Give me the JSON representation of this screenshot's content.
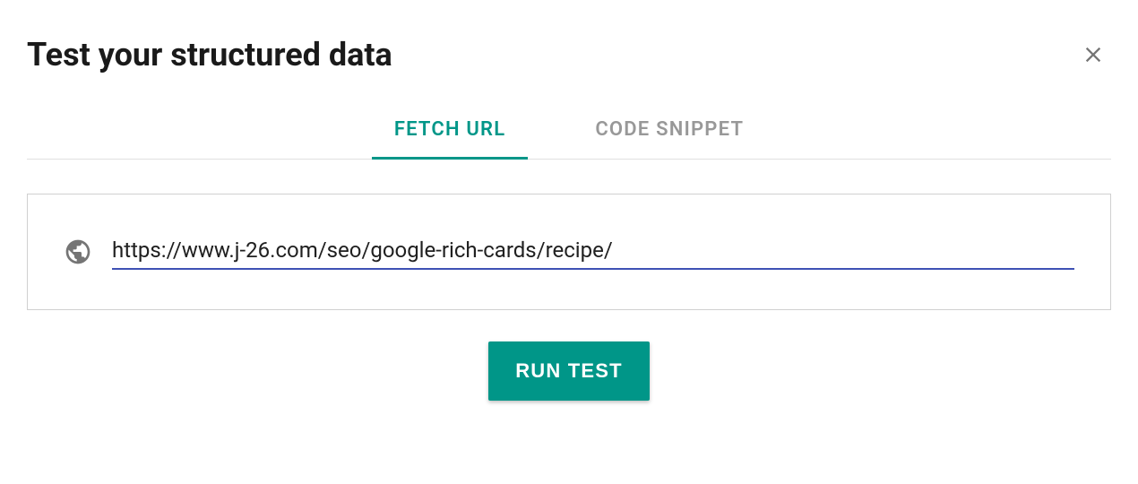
{
  "header": {
    "title": "Test your structured data"
  },
  "tabs": {
    "fetch_url": "FETCH URL",
    "code_snippet": "CODE SNIPPET"
  },
  "input": {
    "url_value": "https://www.j-26.com/seo/google-rich-cards/recipe/"
  },
  "actions": {
    "run_test": "RUN TEST"
  }
}
